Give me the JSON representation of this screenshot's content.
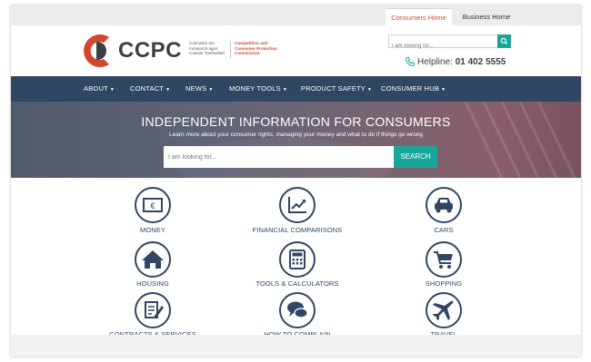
{
  "tabs": {
    "consumers": "Consumers Home",
    "business": "Business Home"
  },
  "logo": {
    "name": "CCPC",
    "irish": [
      "Coimisiún um",
      "Iomaíocht agus",
      "Cosaint Tomhaltóirí"
    ],
    "english": [
      "Competition and",
      "Consumer Protection",
      "Commission"
    ]
  },
  "header_search": {
    "placeholder": "I am looking for..."
  },
  "helpline": {
    "label": "Helpline:",
    "number": "01 402 5555"
  },
  "nav": [
    "ABOUT",
    "CONTACT",
    "NEWS",
    "MONEY TOOLS",
    "PRODUCT SAFETY",
    "CONSUMER HUB"
  ],
  "hero": {
    "title": "INDEPENDENT INFORMATION FOR CONSUMERS",
    "subtitle": "Learn more about your consumer rights, managing your money and what to do if things go wrong",
    "placeholder": "I am looking for...",
    "button": "SEARCH"
  },
  "categories": [
    {
      "label": "MONEY",
      "icon": "money-icon"
    },
    {
      "label": "FINANCIAL COMPARISONS",
      "icon": "chart-trend-icon"
    },
    {
      "label": "CARS",
      "icon": "car-icon"
    },
    {
      "label": "HOUSING",
      "icon": "house-icon"
    },
    {
      "label": "TOOLS & CALCULATORS",
      "icon": "calculator-icon"
    },
    {
      "label": "SHOPPING",
      "icon": "shopping-cart-icon"
    },
    {
      "label": "CONTRACTS & SERVICES",
      "icon": "contract-icon"
    },
    {
      "label": "HOW TO COMPLAIN",
      "icon": "speech-bubbles-icon"
    },
    {
      "label": "TRAVEL",
      "icon": "airplane-icon"
    }
  ],
  "colors": {
    "brand_navy": "#2f4762",
    "brand_red": "#d2462b",
    "accent_teal": "#1aa59a"
  }
}
